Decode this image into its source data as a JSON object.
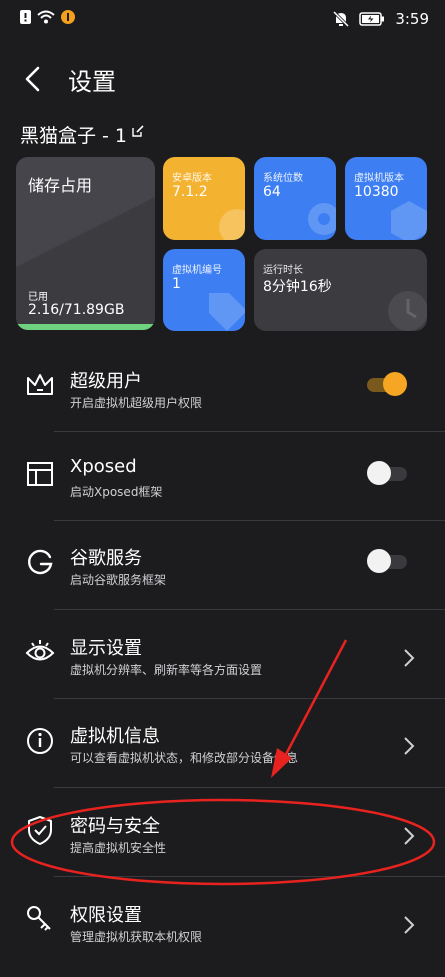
{
  "status_bar": {
    "time": "3:59"
  },
  "header": {
    "title": "设置",
    "device_name": "黑猫盒子 - 1"
  },
  "cards": {
    "storage": {
      "title": "储存占用",
      "used_label": "已用",
      "used_value": "2.16/71.89GB",
      "used_fraction": 0.03
    },
    "android": {
      "label": "安卓版本",
      "value": "7.1.2"
    },
    "bits": {
      "label": "系统位数",
      "value": "64"
    },
    "vm_version": {
      "label": "虚拟机版本",
      "value": "10380"
    },
    "vm_id": {
      "label": "虚拟机编号",
      "value": "1"
    },
    "uptime": {
      "label": "运行时长",
      "value": "8分钟16秒"
    }
  },
  "settings": [
    {
      "title": "超级用户",
      "subtitle": "开启虚拟机超级用户权限",
      "icon": "crown-icon",
      "control": "toggle",
      "on": true
    },
    {
      "title": "Xposed",
      "subtitle": "启动Xposed框架",
      "icon": "frame-icon",
      "control": "toggle",
      "on": false
    },
    {
      "title": "谷歌服务",
      "subtitle": "启动谷歌服务框架",
      "icon": "google-icon",
      "control": "toggle",
      "on": false
    },
    {
      "title": "显示设置",
      "subtitle": "虚拟机分辨率、刷新率等各方面设置",
      "icon": "eye-icon",
      "control": "chevron"
    },
    {
      "title": "虚拟机信息",
      "subtitle": "可以查看虚拟机状态，和修改部分设备信息",
      "icon": "info-icon",
      "control": "chevron"
    },
    {
      "title": "密码与安全",
      "subtitle": "提高虚拟机安全性",
      "icon": "shield-icon",
      "control": "chevron"
    },
    {
      "title": "权限设置",
      "subtitle": "管理虚拟机获取本机权限",
      "icon": "key-icon",
      "control": "chevron"
    }
  ],
  "colors": {
    "accent": "#f6a623",
    "orange_card": "#f4b231",
    "blue_card": "#3d7ff2",
    "annotation_red": "#e8231f"
  }
}
